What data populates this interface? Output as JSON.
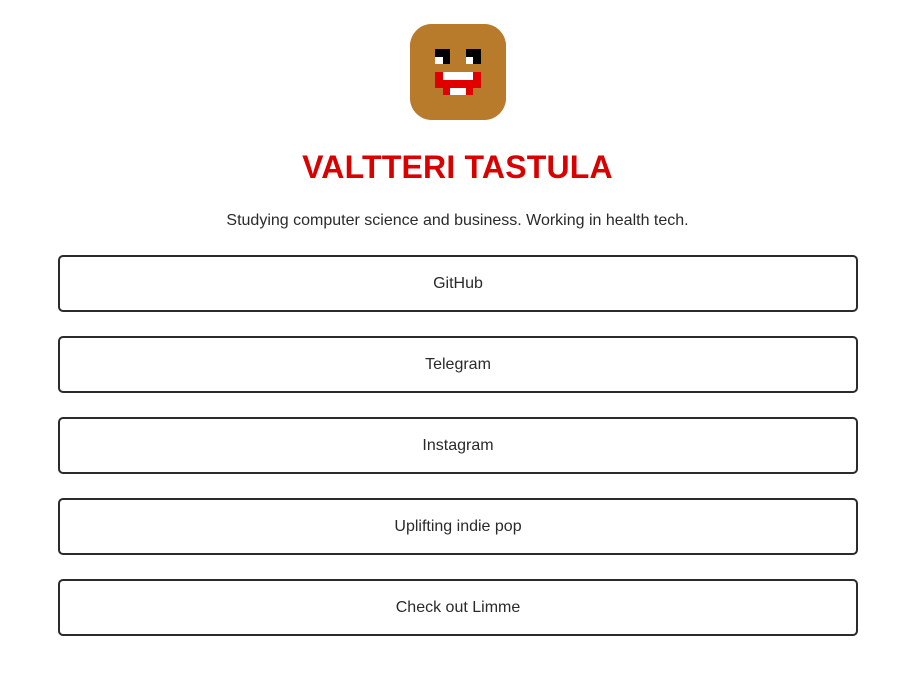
{
  "colors": {
    "accent": "#d90000",
    "avatar_background": "#b87a2b",
    "text": "#222222",
    "button_border": "#2b2b2b"
  },
  "profile": {
    "avatar_icon": "pixel-face-avatar",
    "name": "VALTTERI TASTULA",
    "bio": "Studying computer science and business. Working in health tech."
  },
  "links": [
    {
      "label": "GitHub"
    },
    {
      "label": "Telegram"
    },
    {
      "label": "Instagram"
    },
    {
      "label": "Uplifting indie pop"
    },
    {
      "label": "Check out Limme"
    }
  ]
}
